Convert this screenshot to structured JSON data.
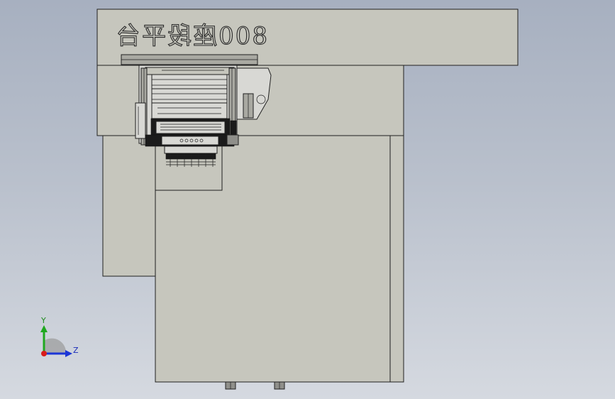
{
  "viewport": {
    "background_top": "#a7b0c0",
    "background_bottom": "#d5d9e0",
    "model_face_color": "#c6c6bd"
  },
  "model": {
    "engraved_text": "800座段平台"
  },
  "triad": {
    "y_label": "Y",
    "z_label": "Z",
    "y_color": "#1fa81f",
    "z_color": "#1b35d6",
    "x_color": "#d81b1b",
    "icon": "coordinate-triad-icon"
  }
}
